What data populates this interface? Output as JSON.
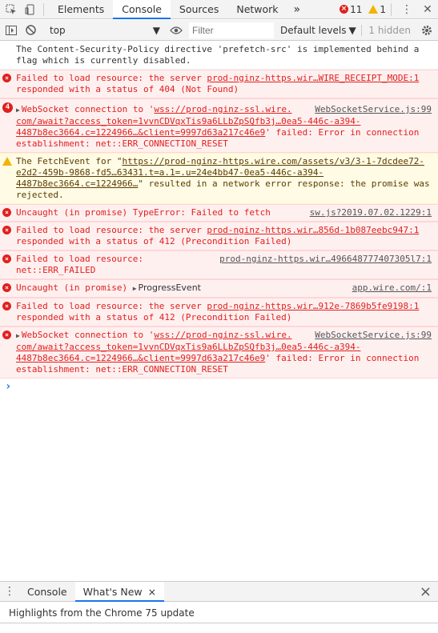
{
  "tabs": [
    "Elements",
    "Console",
    "Sources",
    "Network"
  ],
  "active_tab": "Console",
  "more_tabs": "»",
  "counts": {
    "errors": "11",
    "warnings": "1"
  },
  "filterbar": {
    "context": "top",
    "filter_placeholder": "Filter",
    "levels": "Default levels",
    "hidden": "1 hidden"
  },
  "messages": [
    {
      "type": "info",
      "text": "The Content-Security-Policy directive 'prefetch-src' is implemented behind a flag which is currently disabled."
    },
    {
      "type": "error",
      "prefix": "Failed to load resource: the server ",
      "link": "prod-nginz-https.wir…WIRE_RECEIPT_MODE:1",
      "suffix": " responded with a status of 404 (Not Found)"
    },
    {
      "type": "error-grouped",
      "badge": "4",
      "head": "WebSocket connection to '",
      "url": "wss://prod-nginz-ssl.wire.",
      "source": "WebSocketService.js:99",
      "url2": "com/await?access_token=1vvnCDVqxTis9a6LLbZpSQfb3j…0ea5-446c-a394-4487b8ec3664.c=1224966…&client=9997d63a217c46e9",
      "tail": "' failed: Error in connection establishment: net::ERR_CONNECTION_RESET"
    },
    {
      "type": "warning",
      "head": "The FetchEvent for \"",
      "url": "https://prod-nginz-https.wire.com/assets/v3/3-1-7dcdee72-e2d2-459b-9868-fd5…63431.t=a.1=.u=24e4bb47-0ea5-446c-a394-4487b8ec3664.c=1224966…",
      "tail": "\" resulted in a network error response: the promise was rejected."
    },
    {
      "type": "error",
      "prefix": "Uncaught (in promise) TypeError: Failed to fetch",
      "source": "sw.js?2019.07.02.1229:1"
    },
    {
      "type": "error",
      "prefix": "Failed to load resource: the server ",
      "link": "prod-nginz-https.wir…856d-1b087eebc947:1",
      "suffix": " responded with a status of 412 (Precondition Failed)"
    },
    {
      "type": "error",
      "prefix": "Failed to load resource: ",
      "link": "prod-nginz-https.wir…496648777407305l7:1",
      "suffix": " net::ERR_FAILED"
    },
    {
      "type": "error",
      "prefix": "Uncaught (in promise) ",
      "object": "ProgressEvent",
      "source": "app.wire.com/:1"
    },
    {
      "type": "error",
      "prefix": "Failed to load resource: the server ",
      "link": "prod-nginz-https.wir…912e-7869b5fe9198:1",
      "suffix": " responded with a status of 412 (Precondition Failed)"
    },
    {
      "type": "error-ws",
      "head": "WebSocket connection to '",
      "url": "wss://prod-nginz-ssl.wire.",
      "source": "WebSocketService.js:99",
      "url2": "com/await?access_token=1vvnCDVqxTis9a6LLbZpSQfb3j…0ea5-446c-a394-4487b8ec3664.c=1224966…&client=9997d63a217c46e9",
      "tail": "' failed: Error in connection establishment: net::ERR_CONNECTION_RESET"
    }
  ],
  "prompt": "›",
  "drawer": {
    "tabs": [
      "Console",
      "What's New"
    ],
    "active": "What's New",
    "close_tab": "×",
    "close": "×",
    "body": "Highlights from the Chrome 75 update"
  },
  "colors": {
    "error": "#e0201d",
    "error_bg": "#fff0f0",
    "warning_bg": "#fffbe5",
    "accent": "#1a73e8"
  }
}
